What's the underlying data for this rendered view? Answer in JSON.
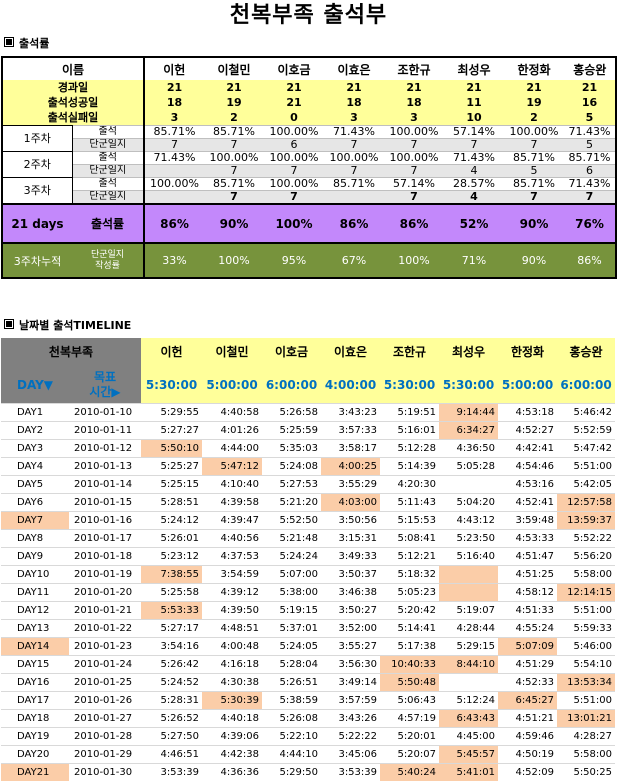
{
  "title": "천복부족 출석부",
  "section1": "출석률",
  "section2": "날짜별 출석TIMELINE",
  "names": [
    "이헌",
    "이철민",
    "이호금",
    "이효은",
    "조한규",
    "최성우",
    "한정화",
    "홍승완"
  ],
  "summary": {
    "name_header": "이름",
    "rows": [
      {
        "label": "경과일",
        "values": [
          "21",
          "21",
          "21",
          "21",
          "21",
          "21",
          "21",
          "21"
        ]
      },
      {
        "label": "출석성공일",
        "values": [
          "18",
          "19",
          "21",
          "18",
          "18",
          "11",
          "19",
          "16"
        ]
      },
      {
        "label": "출석실패일",
        "values": [
          "3",
          "2",
          "0",
          "3",
          "3",
          "10",
          "2",
          "5"
        ]
      }
    ]
  },
  "weeks": [
    {
      "label": "1주차",
      "att_label": "출석",
      "att": [
        "85.71%",
        "85.71%",
        "100.00%",
        "71.43%",
        "100.00%",
        "57.14%",
        "100.00%",
        "71.43%"
      ],
      "diary_label": "단군일지",
      "diary": [
        "7",
        "7",
        "6",
        "7",
        "7",
        "7",
        "7",
        "5"
      ]
    },
    {
      "label": "2주차",
      "att_label": "출석",
      "att": [
        "71.43%",
        "100.00%",
        "100.00%",
        "100.00%",
        "100.00%",
        "71.43%",
        "85.71%",
        "85.71%"
      ],
      "diary_label": "단군일지",
      "diary": [
        "",
        "7",
        "7",
        "7",
        "7",
        "4",
        "5",
        "6"
      ]
    },
    {
      "label": "3주차",
      "att_label": "출석",
      "att": [
        "100.00%",
        "85.71%",
        "100.00%",
        "85.71%",
        "57.14%",
        "28.57%",
        "85.71%",
        "71.43%"
      ],
      "diary_label": "단군일지",
      "diary": [
        "",
        "7",
        "7",
        "",
        "7",
        "4",
        "7",
        "7"
      ]
    }
  ],
  "rate": {
    "days": "21 days",
    "label": "출석률",
    "values": [
      "86%",
      "90%",
      "100%",
      "86%",
      "86%",
      "52%",
      "90%",
      "76%"
    ]
  },
  "cumulative": {
    "label": "3주차누적",
    "sub1": "단군일지",
    "sub2": "작성률",
    "values": [
      "33%",
      "100%",
      "95%",
      "67%",
      "100%",
      "71%",
      "90%",
      "86%"
    ]
  },
  "timeline": {
    "corner": "천복부족",
    "day_label": "DAY▼",
    "target_label1": "목표",
    "target_label2": "시간▶",
    "targets": [
      "5:30:00",
      "5:00:00",
      "6:00:00",
      "4:00:00",
      "5:30:00",
      "5:30:00",
      "5:00:00",
      "6:00:00"
    ],
    "rows": [
      {
        "day": "DAY1",
        "date": "2010-01-10",
        "times": [
          "5:29:55",
          "4:40:58",
          "5:26:58",
          "3:43:23",
          "5:19:51",
          "9:14:44",
          "4:53:18",
          "5:46:42"
        ]
      },
      {
        "day": "DAY2",
        "date": "2010-01-11",
        "times": [
          "5:27:27",
          "4:01:26",
          "5:25:59",
          "3:57:33",
          "5:16:01",
          "6:34:27",
          "4:52:27",
          "5:52:59"
        ]
      },
      {
        "day": "DAY3",
        "date": "2010-01-12",
        "times": [
          "5:50:10",
          "4:44:00",
          "5:35:03",
          "3:58:17",
          "5:12:28",
          "4:36:50",
          "4:42:41",
          "5:47:42"
        ]
      },
      {
        "day": "DAY4",
        "date": "2010-01-13",
        "times": [
          "5:25:27",
          "5:47:12",
          "5:24:08",
          "4:00:25",
          "5:14:39",
          "5:05:28",
          "4:54:46",
          "5:51:00"
        ]
      },
      {
        "day": "DAY5",
        "date": "2010-01-14",
        "times": [
          "5:25:15",
          "4:10:40",
          "5:27:53",
          "3:55:29",
          "4:20:30",
          "",
          "4:53:16",
          "5:42:05"
        ]
      },
      {
        "day": "DAY6",
        "date": "2010-01-15",
        "times": [
          "5:28:51",
          "4:39:58",
          "5:21:20",
          "4:03:00",
          "5:11:43",
          "5:04:20",
          "4:52:41",
          "12:57:58"
        ]
      },
      {
        "day": "DAY7",
        "date": "2010-01-16",
        "times": [
          "5:24:12",
          "4:39:47",
          "5:52:50",
          "3:50:56",
          "5:15:53",
          "4:43:12",
          "3:59:48",
          "13:59:37"
        ]
      },
      {
        "day": "DAY8",
        "date": "2010-01-17",
        "times": [
          "5:26:01",
          "4:40:56",
          "5:21:48",
          "3:15:31",
          "5:08:41",
          "5:23:50",
          "4:53:33",
          "5:52:22"
        ]
      },
      {
        "day": "DAY9",
        "date": "2010-01-18",
        "times": [
          "5:23:12",
          "4:37:53",
          "5:24:24",
          "3:49:33",
          "5:12:21",
          "5:16:40",
          "4:51:47",
          "5:56:20"
        ]
      },
      {
        "day": "DAY10",
        "date": "2010-01-19",
        "times": [
          "7:38:55",
          "3:54:59",
          "5:07:00",
          "3:50:37",
          "5:18:32",
          "",
          "4:51:25",
          "5:58:00"
        ]
      },
      {
        "day": "DAY11",
        "date": "2010-01-20",
        "times": [
          "5:25:58",
          "4:39:12",
          "5:38:00",
          "3:46:38",
          "5:05:23",
          "",
          "4:58:12",
          "12:14:15"
        ]
      },
      {
        "day": "DAY12",
        "date": "2010-01-21",
        "times": [
          "5:53:33",
          "4:39:50",
          "5:19:15",
          "3:50:27",
          "5:20:42",
          "5:19:07",
          "4:51:33",
          "5:51:00"
        ]
      },
      {
        "day": "DAY13",
        "date": "2010-01-22",
        "times": [
          "5:27:17",
          "4:48:51",
          "5:37:01",
          "3:52:00",
          "5:14:41",
          "4:28:44",
          "4:55:24",
          "5:59:33"
        ]
      },
      {
        "day": "DAY14",
        "date": "2010-01-23",
        "times": [
          "3:54:16",
          "4:00:48",
          "5:24:05",
          "3:55:27",
          "5:17:38",
          "5:29:15",
          "5:07:09",
          "5:46:00"
        ]
      },
      {
        "day": "DAY15",
        "date": "2010-01-24",
        "times": [
          "5:26:42",
          "4:16:18",
          "5:28:04",
          "3:56:30",
          "10:40:33",
          "8:44:10",
          "4:51:29",
          "5:54:10"
        ]
      },
      {
        "day": "DAY16",
        "date": "2010-01-25",
        "times": [
          "5:24:52",
          "4:30:38",
          "5:26:51",
          "3:49:14",
          "5:50:48",
          "",
          "4:52:33",
          "13:53:34"
        ]
      },
      {
        "day": "DAY17",
        "date": "2010-01-26",
        "times": [
          "5:28:31",
          "5:30:39",
          "5:38:59",
          "3:57:59",
          "5:06:43",
          "5:12:24",
          "6:45:27",
          "5:51:00"
        ]
      },
      {
        "day": "DAY18",
        "date": "2010-01-27",
        "times": [
          "5:26:52",
          "4:40:18",
          "5:26:08",
          "3:43:26",
          "4:57:19",
          "6:43:43",
          "4:51:21",
          "13:01:21"
        ]
      },
      {
        "day": "DAY19",
        "date": "2010-01-28",
        "times": [
          "5:27:50",
          "4:39:06",
          "5:22:10",
          "5:22:22",
          "5:20:01",
          "4:45:00",
          "4:59:46",
          "4:28:27"
        ]
      },
      {
        "day": "DAY20",
        "date": "2010-01-29",
        "times": [
          "4:46:51",
          "4:42:38",
          "4:44:10",
          "3:45:06",
          "5:20:07",
          "5:45:57",
          "4:50:19",
          "5:58:00"
        ]
      },
      {
        "day": "DAY21",
        "date": "2010-01-30",
        "times": [
          "3:53:39",
          "4:36:36",
          "5:29:50",
          "3:53:39",
          "5:40:24",
          "5:41:01",
          "4:52:09",
          "5:50:25"
        ]
      }
    ],
    "highlights": {
      "0": [
        5
      ],
      "1": [
        5
      ],
      "2": [
        0
      ],
      "3": [
        1,
        3
      ],
      "5": [
        3,
        7
      ],
      "6": [
        7
      ],
      "9": [
        0,
        5
      ],
      "10": [
        5,
        7
      ],
      "11": [
        0
      ],
      "13": [
        6
      ],
      "14": [
        4,
        5
      ],
      "15": [
        4,
        7
      ],
      "16": [
        1,
        6
      ],
      "17": [
        5,
        7
      ],
      "19": [
        5
      ],
      "20": [
        4,
        5
      ]
    },
    "day_highlights": [
      6,
      13,
      20
    ]
  }
}
